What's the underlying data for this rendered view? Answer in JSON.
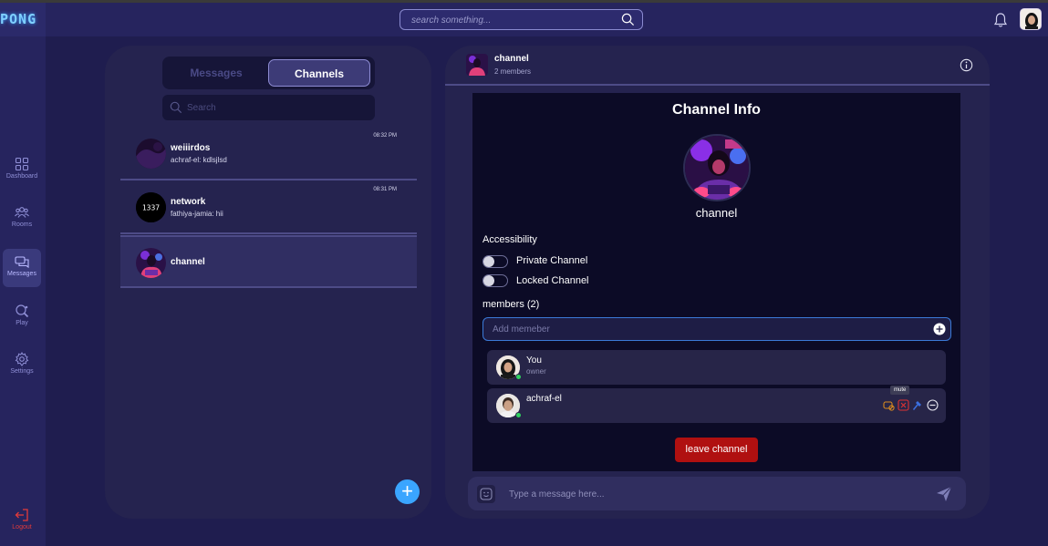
{
  "app": {
    "logo_text": "PONG"
  },
  "topbar": {
    "search_placeholder": "search something..."
  },
  "sidebar": {
    "items": [
      {
        "label": "Dashboard",
        "icon": "grid-icon",
        "active": false
      },
      {
        "label": "Rooms",
        "icon": "users-icon",
        "active": false
      },
      {
        "label": "Messages",
        "icon": "chat-icon",
        "active": true
      },
      {
        "label": "Play",
        "icon": "ping-pong-icon",
        "active": false
      },
      {
        "label": "Settings",
        "icon": "gear-icon",
        "active": false
      }
    ],
    "logout_label": "Logout"
  },
  "left": {
    "tabs": {
      "messages": "Messages",
      "channels": "Channels"
    },
    "search_placeholder": "Search",
    "conversations": [
      {
        "name": "weiiirdos",
        "last": "achraf-el: kdlsjlsd",
        "time": "08:32 PM"
      },
      {
        "name": "network",
        "last": "fathiya-jamia: hii",
        "time": "08:31 PM",
        "avatar_text": "1337"
      },
      {
        "name": "channel",
        "last": "",
        "time": ""
      }
    ],
    "fab_label": "+"
  },
  "right": {
    "header": {
      "name": "channel",
      "sub": "2 members"
    },
    "info": {
      "title": "Channel Info",
      "name": "channel",
      "accessibility_label": "Accessibility",
      "private_label": "Private Channel",
      "locked_label": "Locked Channel",
      "members_label": "members (2)",
      "add_placeholder": "Add memeber",
      "members": [
        {
          "name": "You",
          "role": "owner"
        },
        {
          "name": "achraf-el",
          "role": ""
        }
      ],
      "tooltip": "mute",
      "leave_label": "leave channel"
    },
    "composer": {
      "placeholder": "Type a message here..."
    }
  },
  "colors": {
    "accent": "#3aa5ff",
    "danger": "#b01010",
    "online": "#2fd15f"
  }
}
